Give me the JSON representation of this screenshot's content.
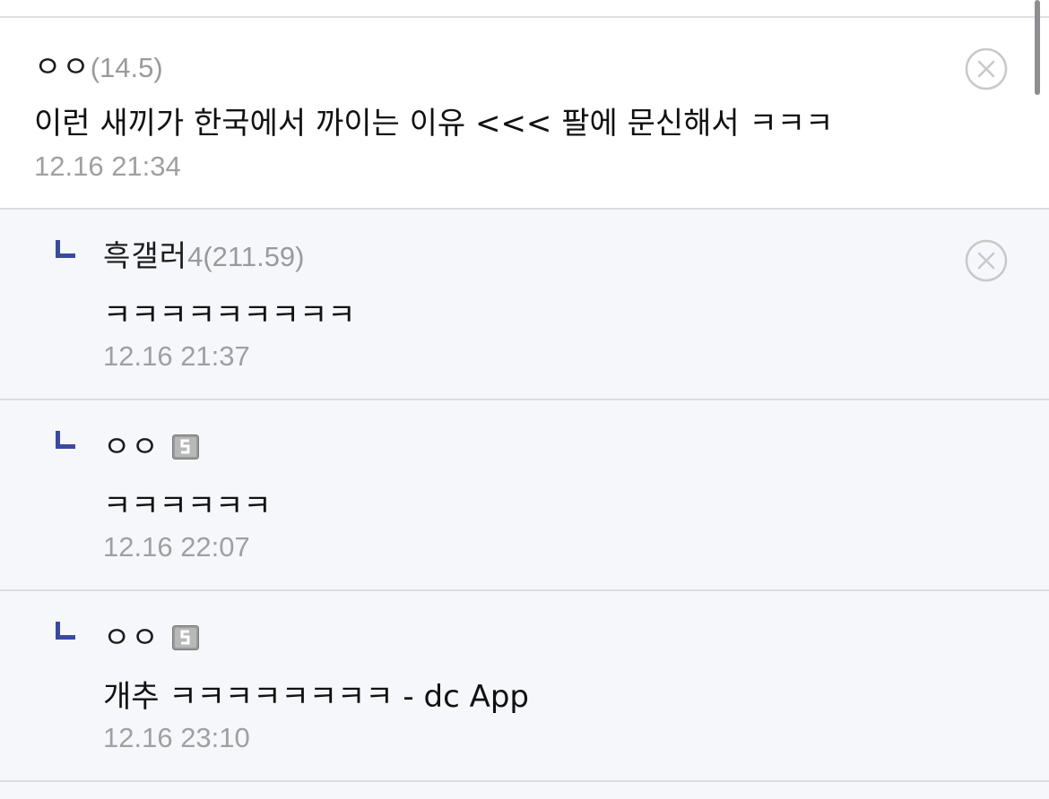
{
  "comments": [
    {
      "nickname": "ㅇㅇ",
      "ip": "(14.5)",
      "text": "이런 새끼가 한국에서 까이는 이유 <<< 팔에 문신해서 ㅋㅋㅋ",
      "timestamp": "12.16 21:34",
      "delete_icon": "circle-x-icon"
    }
  ],
  "replies": [
    {
      "reply_icon": "reply-corner-icon",
      "nickname": "흑갤러",
      "ip": "4(211.59)",
      "text": "ㅋㅋㅋㅋㅋㅋㅋㅋㅋ",
      "timestamp": "12.16 21:37",
      "delete_icon": "circle-x-icon"
    },
    {
      "reply_icon": "reply-corner-icon",
      "nickname": "ㅇㅇ",
      "badge_icon": "fixed-nick-badge-icon",
      "text": "ㅋㅋㅋㅋㅋㅋ",
      "timestamp": "12.16 22:07"
    },
    {
      "reply_icon": "reply-corner-icon",
      "nickname": "ㅇㅇ",
      "badge_icon": "fixed-nick-badge-icon",
      "text": "개추 ㅋㅋㅋㅋㅋㅋㅋㅋ - dc App",
      "timestamp": "12.16 23:10"
    }
  ],
  "colors": {
    "reply_accent": "#3b4a9e",
    "timestamp": "#a0a0a0",
    "ip": "#9a9a9a",
    "reply_bg": "#f6f7fb"
  }
}
